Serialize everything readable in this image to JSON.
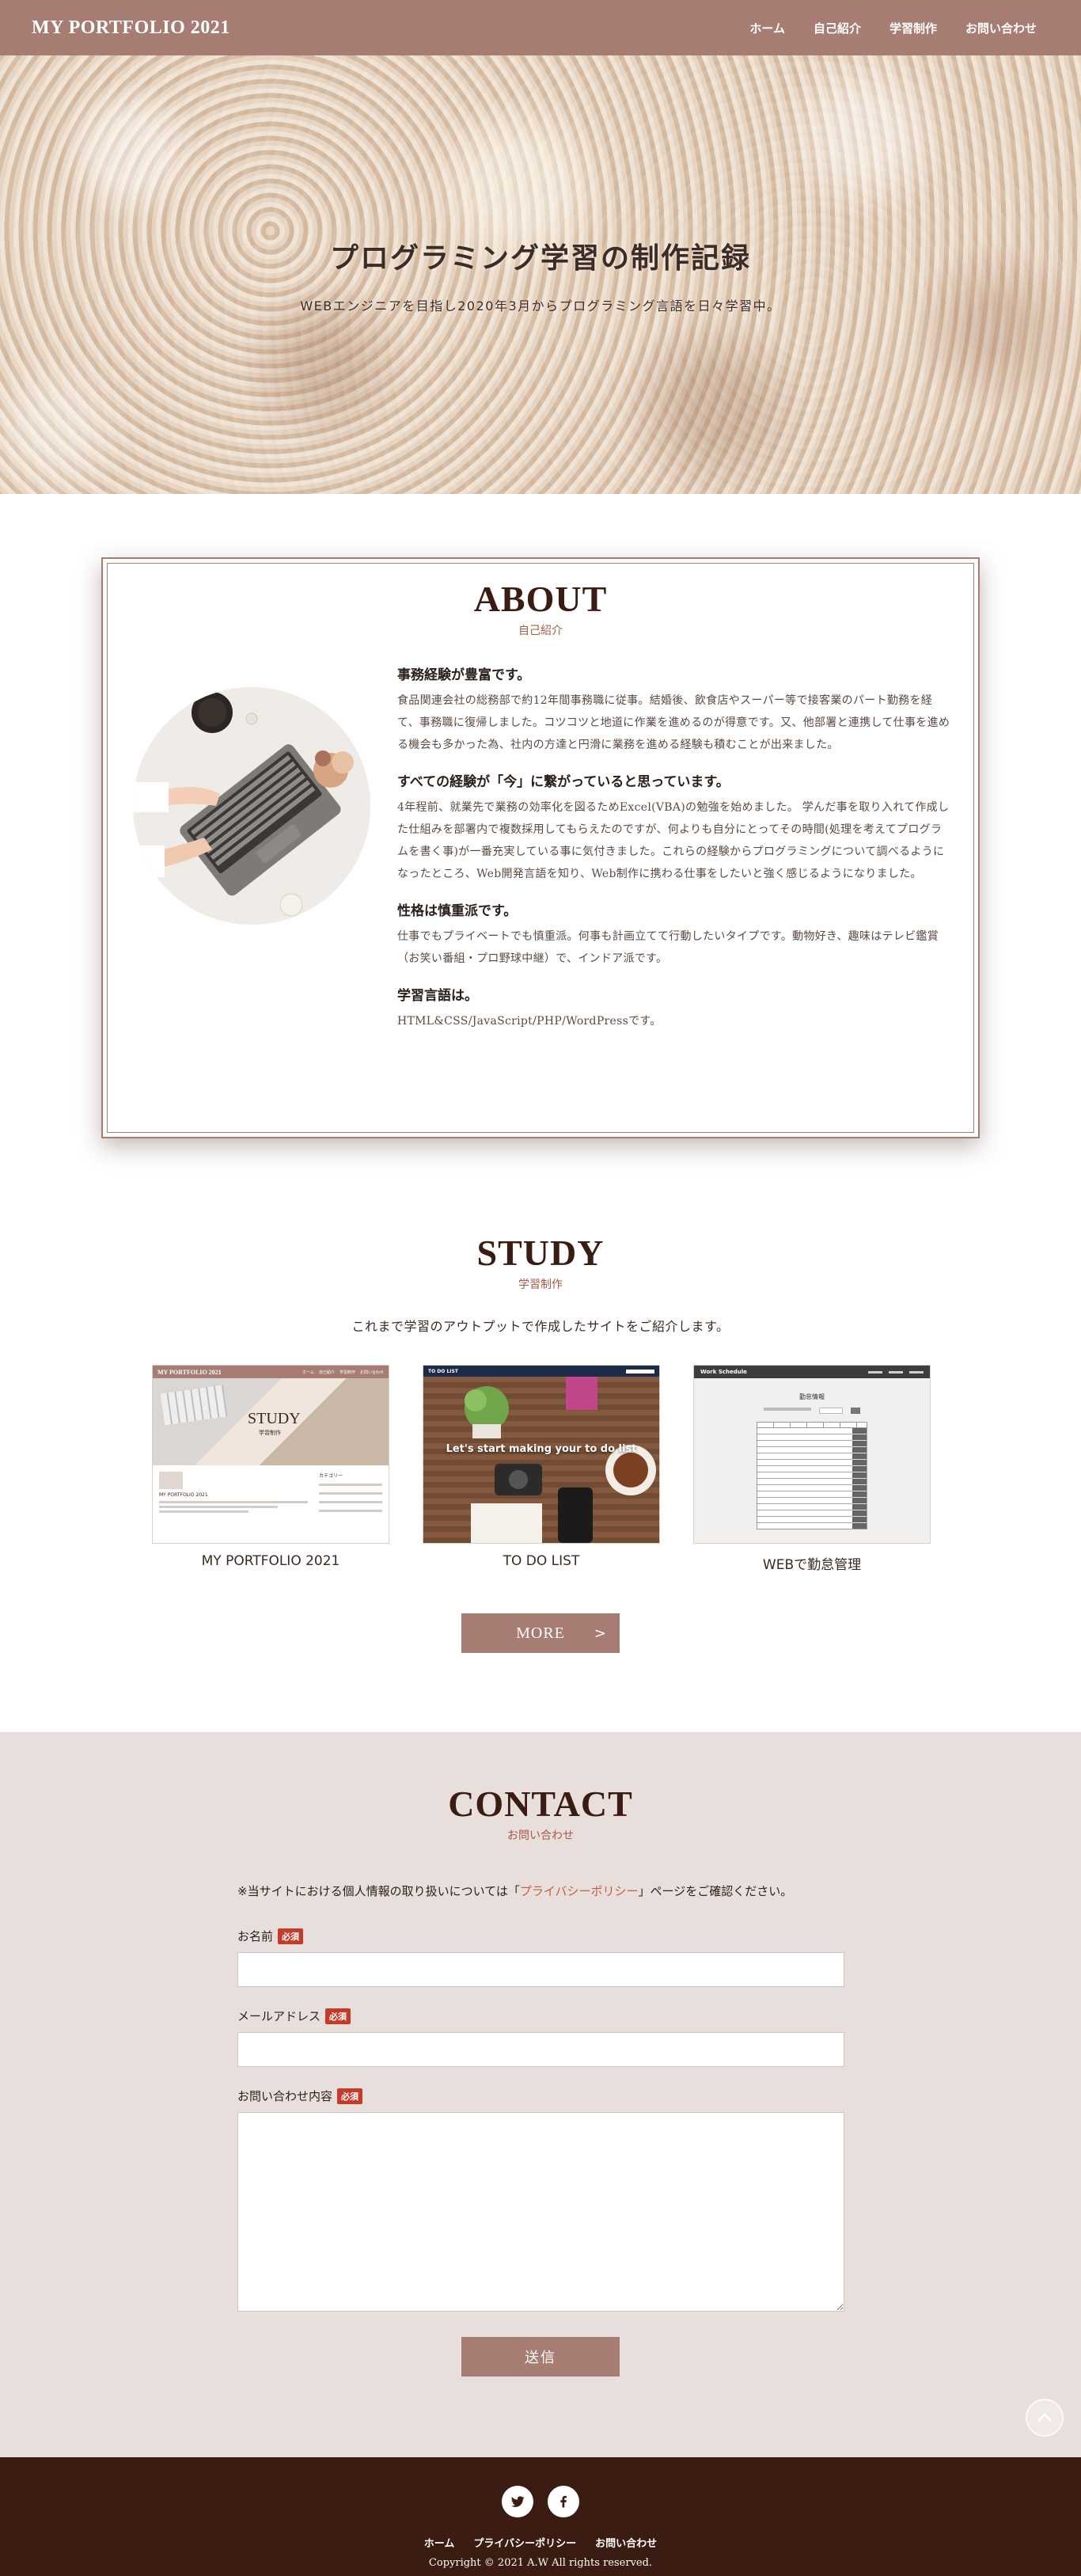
{
  "header": {
    "logo": "MY PORTFOLIO 2021",
    "nav": [
      "ホーム",
      "自己紹介",
      "学習制作",
      "お問い合わせ"
    ]
  },
  "hero": {
    "title": "プログラミング学習の制作記録",
    "subtitle": "WEBエンジニアを目指し2020年3月からプログラミング言語を日々学習中。"
  },
  "about": {
    "title": "ABOUT",
    "subtitle": "自己紹介",
    "blocks": [
      {
        "heading": "事務経験が豊富です。",
        "body": "食品関連会社の総務部で約12年間事務職に従事。結婚後、飲食店やスーパー等で接客業のパート勤務を経て、事務職に復帰しました。コツコツと地道に作業を進めるのが得意です。又、他部署と連携して仕事を進める機会も多かった為、社内の方達と円滑に業務を進める経験も積むことが出来ました。"
      },
      {
        "heading": "すべての経験が「今」に繋がっていると思っています。",
        "body": "4年程前、就業先で業務の効率化を図るためExcel(VBA)の勉強を始めました。 学んだ事を取り入れて作成した仕組みを部署内で複数採用してもらえたのですが、何よりも自分にとってその時間(処理を考えてプログラムを書く事)が一番充実している事に気付きました。これらの経験からプログラミングについて調べるようになったところ、Web開発言語を知り、Web制作に携わる仕事をしたいと強く感じるようになりました。"
      },
      {
        "heading": "性格は慎重派です。",
        "body": "仕事でもプライベートでも慎重派。何事も計画立てて行動したいタイプです。動物好き、趣味はテレビ鑑賞（お笑い番組・プロ野球中継）で、インドア派です。"
      },
      {
        "heading": "学習言語は。",
        "body": "HTML&CSS/JavaScript/PHP/WordPressです。"
      }
    ]
  },
  "study": {
    "title": "STUDY",
    "subtitle": "学習制作",
    "intro": "これまで学習のアウトプットで作成したサイトをご紹介します。",
    "works": [
      {
        "title": "MY PORTFOLIO 2021",
        "thumb_header": "MY PORTFOLIO 2021",
        "thumb_nav": [
          "ホーム",
          "自己紹介",
          "学習制作",
          "お問い合わせ"
        ],
        "thumb_hero": "STUDY",
        "thumb_hero_sub": "学習制作",
        "thumb_post_title": "MY PORTFOLIO 2021",
        "thumb_side_title": "カテゴリー"
      },
      {
        "title": "TO DO LIST",
        "thumb_header": "TO DO LIST",
        "thumb_overlay": "Let's start making your to do list"
      },
      {
        "title": "WEBで勤怠管理",
        "thumb_header": "Work Schedule",
        "thumb_heading": "勤怠情報"
      }
    ],
    "more_label": "MORE",
    "more_arrow": ">"
  },
  "contact": {
    "title": "CONTACT",
    "subtitle": "お問い合わせ",
    "privacy_prefix": "※当サイトにおける個人情報の取り扱いについては「",
    "privacy_link": "プライバシーポリシー",
    "privacy_suffix": "」ページをご確認ください。",
    "required": "必須",
    "fields": {
      "name": "お名前",
      "email": "メールアドレス",
      "message": "お問い合わせ内容"
    },
    "submit": "送信"
  },
  "footer": {
    "socials": [
      "twitter-icon",
      "facebook-icon"
    ],
    "nav": [
      "ホーム",
      "プライバシーポリシー",
      "お問い合わせ"
    ],
    "copyright": "Copyright © 2021 A.W All rights reserved."
  },
  "colors": {
    "brand": "#a67c73",
    "dark": "#3a1c12",
    "accent": "#c0604a",
    "contact_bg": "#e8dedc",
    "required": "#c43b2a"
  }
}
